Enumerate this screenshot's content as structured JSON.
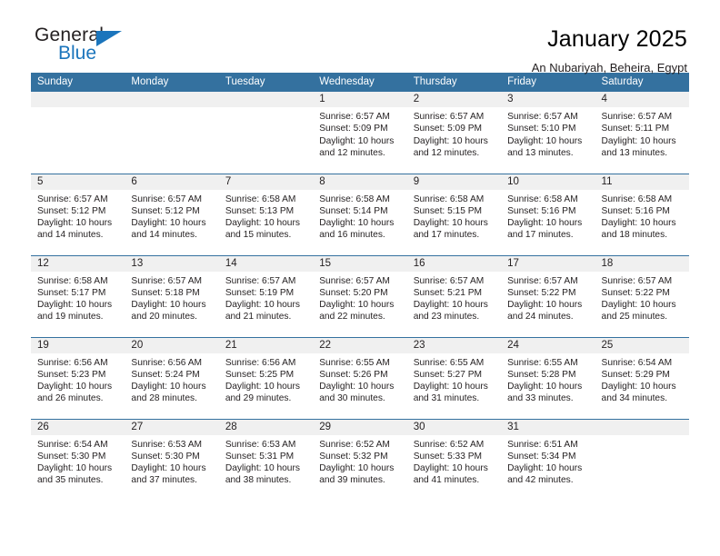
{
  "brand": {
    "name_line1": "General",
    "name_line2": "Blue",
    "triangle_icon": "triangle-icon",
    "accent_color": "#1b75bc"
  },
  "header": {
    "title": "January 2025",
    "subtitle": "An Nubariyah, Beheira, Egypt"
  },
  "calendar": {
    "header_bg": "#34719f",
    "daynum_bg": "#f0f0f0",
    "columns": [
      "Sunday",
      "Monday",
      "Tuesday",
      "Wednesday",
      "Thursday",
      "Friday",
      "Saturday"
    ],
    "labels": {
      "sunrise": "Sunrise:",
      "sunset": "Sunset:",
      "daylight": "Daylight:"
    },
    "weeks": [
      [
        {
          "day": "",
          "empty": true
        },
        {
          "day": "",
          "empty": true
        },
        {
          "day": "",
          "empty": true
        },
        {
          "day": "1",
          "sunrise": "Sunrise: 6:57 AM",
          "sunset": "Sunset: 5:09 PM",
          "daylight_l1": "Daylight: 10 hours",
          "daylight_l2": "and 12 minutes."
        },
        {
          "day": "2",
          "sunrise": "Sunrise: 6:57 AM",
          "sunset": "Sunset: 5:09 PM",
          "daylight_l1": "Daylight: 10 hours",
          "daylight_l2": "and 12 minutes."
        },
        {
          "day": "3",
          "sunrise": "Sunrise: 6:57 AM",
          "sunset": "Sunset: 5:10 PM",
          "daylight_l1": "Daylight: 10 hours",
          "daylight_l2": "and 13 minutes."
        },
        {
          "day": "4",
          "sunrise": "Sunrise: 6:57 AM",
          "sunset": "Sunset: 5:11 PM",
          "daylight_l1": "Daylight: 10 hours",
          "daylight_l2": "and 13 minutes."
        }
      ],
      [
        {
          "day": "5",
          "sunrise": "Sunrise: 6:57 AM",
          "sunset": "Sunset: 5:12 PM",
          "daylight_l1": "Daylight: 10 hours",
          "daylight_l2": "and 14 minutes."
        },
        {
          "day": "6",
          "sunrise": "Sunrise: 6:57 AM",
          "sunset": "Sunset: 5:12 PM",
          "daylight_l1": "Daylight: 10 hours",
          "daylight_l2": "and 14 minutes."
        },
        {
          "day": "7",
          "sunrise": "Sunrise: 6:58 AM",
          "sunset": "Sunset: 5:13 PM",
          "daylight_l1": "Daylight: 10 hours",
          "daylight_l2": "and 15 minutes."
        },
        {
          "day": "8",
          "sunrise": "Sunrise: 6:58 AM",
          "sunset": "Sunset: 5:14 PM",
          "daylight_l1": "Daylight: 10 hours",
          "daylight_l2": "and 16 minutes."
        },
        {
          "day": "9",
          "sunrise": "Sunrise: 6:58 AM",
          "sunset": "Sunset: 5:15 PM",
          "daylight_l1": "Daylight: 10 hours",
          "daylight_l2": "and 17 minutes."
        },
        {
          "day": "10",
          "sunrise": "Sunrise: 6:58 AM",
          "sunset": "Sunset: 5:16 PM",
          "daylight_l1": "Daylight: 10 hours",
          "daylight_l2": "and 17 minutes."
        },
        {
          "day": "11",
          "sunrise": "Sunrise: 6:58 AM",
          "sunset": "Sunset: 5:16 PM",
          "daylight_l1": "Daylight: 10 hours",
          "daylight_l2": "and 18 minutes."
        }
      ],
      [
        {
          "day": "12",
          "sunrise": "Sunrise: 6:58 AM",
          "sunset": "Sunset: 5:17 PM",
          "daylight_l1": "Daylight: 10 hours",
          "daylight_l2": "and 19 minutes."
        },
        {
          "day": "13",
          "sunrise": "Sunrise: 6:57 AM",
          "sunset": "Sunset: 5:18 PM",
          "daylight_l1": "Daylight: 10 hours",
          "daylight_l2": "and 20 minutes."
        },
        {
          "day": "14",
          "sunrise": "Sunrise: 6:57 AM",
          "sunset": "Sunset: 5:19 PM",
          "daylight_l1": "Daylight: 10 hours",
          "daylight_l2": "and 21 minutes."
        },
        {
          "day": "15",
          "sunrise": "Sunrise: 6:57 AM",
          "sunset": "Sunset: 5:20 PM",
          "daylight_l1": "Daylight: 10 hours",
          "daylight_l2": "and 22 minutes."
        },
        {
          "day": "16",
          "sunrise": "Sunrise: 6:57 AM",
          "sunset": "Sunset: 5:21 PM",
          "daylight_l1": "Daylight: 10 hours",
          "daylight_l2": "and 23 minutes."
        },
        {
          "day": "17",
          "sunrise": "Sunrise: 6:57 AM",
          "sunset": "Sunset: 5:22 PM",
          "daylight_l1": "Daylight: 10 hours",
          "daylight_l2": "and 24 minutes."
        },
        {
          "day": "18",
          "sunrise": "Sunrise: 6:57 AM",
          "sunset": "Sunset: 5:22 PM",
          "daylight_l1": "Daylight: 10 hours",
          "daylight_l2": "and 25 minutes."
        }
      ],
      [
        {
          "day": "19",
          "sunrise": "Sunrise: 6:56 AM",
          "sunset": "Sunset: 5:23 PM",
          "daylight_l1": "Daylight: 10 hours",
          "daylight_l2": "and 26 minutes."
        },
        {
          "day": "20",
          "sunrise": "Sunrise: 6:56 AM",
          "sunset": "Sunset: 5:24 PM",
          "daylight_l1": "Daylight: 10 hours",
          "daylight_l2": "and 28 minutes."
        },
        {
          "day": "21",
          "sunrise": "Sunrise: 6:56 AM",
          "sunset": "Sunset: 5:25 PM",
          "daylight_l1": "Daylight: 10 hours",
          "daylight_l2": "and 29 minutes."
        },
        {
          "day": "22",
          "sunrise": "Sunrise: 6:55 AM",
          "sunset": "Sunset: 5:26 PM",
          "daylight_l1": "Daylight: 10 hours",
          "daylight_l2": "and 30 minutes."
        },
        {
          "day": "23",
          "sunrise": "Sunrise: 6:55 AM",
          "sunset": "Sunset: 5:27 PM",
          "daylight_l1": "Daylight: 10 hours",
          "daylight_l2": "and 31 minutes."
        },
        {
          "day": "24",
          "sunrise": "Sunrise: 6:55 AM",
          "sunset": "Sunset: 5:28 PM",
          "daylight_l1": "Daylight: 10 hours",
          "daylight_l2": "and 33 minutes."
        },
        {
          "day": "25",
          "sunrise": "Sunrise: 6:54 AM",
          "sunset": "Sunset: 5:29 PM",
          "daylight_l1": "Daylight: 10 hours",
          "daylight_l2": "and 34 minutes."
        }
      ],
      [
        {
          "day": "26",
          "sunrise": "Sunrise: 6:54 AM",
          "sunset": "Sunset: 5:30 PM",
          "daylight_l1": "Daylight: 10 hours",
          "daylight_l2": "and 35 minutes."
        },
        {
          "day": "27",
          "sunrise": "Sunrise: 6:53 AM",
          "sunset": "Sunset: 5:30 PM",
          "daylight_l1": "Daylight: 10 hours",
          "daylight_l2": "and 37 minutes."
        },
        {
          "day": "28",
          "sunrise": "Sunrise: 6:53 AM",
          "sunset": "Sunset: 5:31 PM",
          "daylight_l1": "Daylight: 10 hours",
          "daylight_l2": "and 38 minutes."
        },
        {
          "day": "29",
          "sunrise": "Sunrise: 6:52 AM",
          "sunset": "Sunset: 5:32 PM",
          "daylight_l1": "Daylight: 10 hours",
          "daylight_l2": "and 39 minutes."
        },
        {
          "day": "30",
          "sunrise": "Sunrise: 6:52 AM",
          "sunset": "Sunset: 5:33 PM",
          "daylight_l1": "Daylight: 10 hours",
          "daylight_l2": "and 41 minutes."
        },
        {
          "day": "31",
          "sunrise": "Sunrise: 6:51 AM",
          "sunset": "Sunset: 5:34 PM",
          "daylight_l1": "Daylight: 10 hours",
          "daylight_l2": "and 42 minutes."
        },
        {
          "day": "",
          "empty": true
        }
      ]
    ]
  }
}
